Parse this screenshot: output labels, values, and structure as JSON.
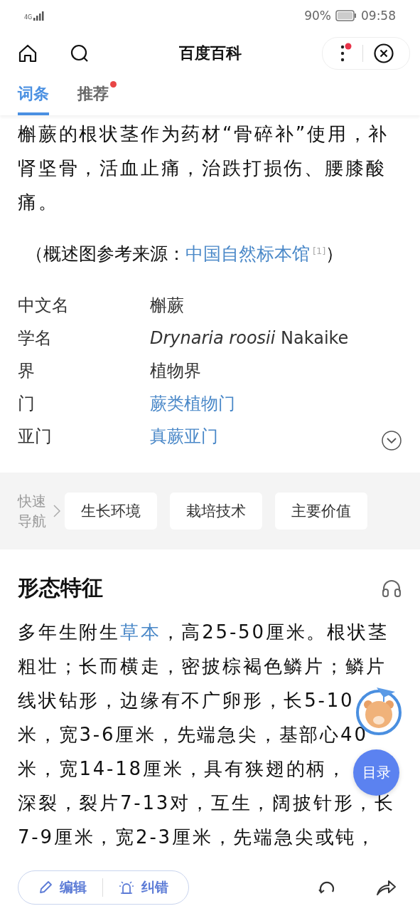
{
  "status_bar": {
    "network": "4G",
    "battery": "90%",
    "time": "09:58"
  },
  "header": {
    "title": "百度百科",
    "menu_dot": true
  },
  "tabs": [
    {
      "label": "词条",
      "selected": true,
      "dot": false
    },
    {
      "label": "推荐",
      "selected": false,
      "dot": true
    }
  ],
  "intro": {
    "lines": [
      "槲蕨的根状茎作为药材“骨碎补”使用，补",
      "肾坚骨，活血止痛，治跌打损伤、腰膝酸",
      "痛。"
    ]
  },
  "source": {
    "before": "（概述图参考来源：",
    "link": "中国自然标本馆",
    "ref": "[1]",
    "after": "）"
  },
  "info": [
    {
      "label": "中文名",
      "value": "槲蕨",
      "link": false
    },
    {
      "label": "学名",
      "value": "*Drynaria roosii* Nakaike",
      "link": false
    },
    {
      "label": "界",
      "value": "植物界",
      "link": false
    },
    {
      "label": "门",
      "value": "蕨类植物门",
      "link": true
    },
    {
      "label": "亚门",
      "value": "真蕨亚门",
      "link": true
    }
  ],
  "quick_nav": {
    "label": "快速导航",
    "items": [
      "生长环境",
      "栽培技术",
      "主要价值"
    ]
  },
  "section": {
    "title": "形态特征",
    "lines": [
      [
        {
          "text": "多年生附生",
          "link": false
        },
        {
          "text": "草本",
          "link": true
        },
        {
          "text": "，高25-50厘米。根状茎",
          "link": false
        }
      ],
      [
        {
          "text": "粗壮；长而横走，密披棕褐色鳞片；鳞片",
          "link": false
        }
      ],
      [
        {
          "text": "线状钻形，边缘有不广卵形，长5-10",
          "link": false
        }
      ],
      [
        {
          "text": "米，宽3-6厘米，先端急尖，基部心40",
          "link": false
        }
      ],
      [
        {
          "text": "米，宽14-18厘米，具有狭翅的柄，",
          "link": false
        }
      ],
      [
        {
          "text": "深裂，裂片7-13对，互生，阔披针形，长",
          "link": false
        }
      ],
      [
        {
          "text": "7-9厘米，宽2-3厘米，先端急尖或钝，",
          "link": false
        }
      ]
    ]
  },
  "toc_button": "目录",
  "bottom_bar": {
    "edit": "编辑",
    "report": "纠错"
  }
}
